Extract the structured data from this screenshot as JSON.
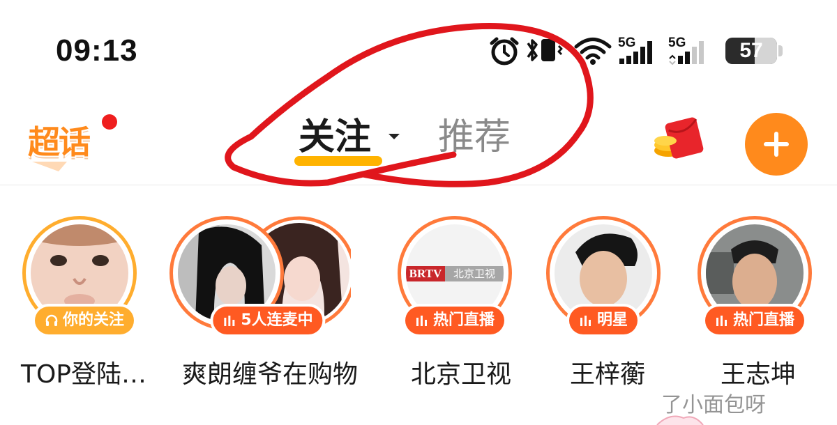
{
  "status_bar": {
    "time": "09:13",
    "network_1": "5G",
    "network_2": "5G",
    "battery": "57",
    "icons": [
      "alarm-icon",
      "bluetooth-icon",
      "vibrate-icon",
      "wifi-icon",
      "signal-icon",
      "battery-icon"
    ]
  },
  "header": {
    "logo_text": "超话",
    "tabs": [
      {
        "label": "关注",
        "active": true
      },
      {
        "label": "推荐",
        "active": false
      }
    ],
    "accent_color": "#ff8a1c"
  },
  "stories": [
    {
      "name": "TOP登陆…",
      "badge": "你的关注",
      "badge_icon": "headphones-icon"
    },
    {
      "name": "爽朗缠爷在购物",
      "badge": "5人连麦中",
      "badge_icon": "equalizer-icon"
    },
    {
      "name": "北京卫视",
      "badge": "热门直播",
      "badge_icon": "equalizer-icon",
      "avatar_text": {
        "left": "BRTV",
        "right": "北京卫视"
      }
    },
    {
      "name": "王梓蘅",
      "badge": "明星",
      "badge_icon": "equalizer-icon"
    },
    {
      "name": "王志坤",
      "badge": "热门直播",
      "badge_icon": "equalizer-icon"
    }
  ],
  "watermark": "了小面包呀"
}
